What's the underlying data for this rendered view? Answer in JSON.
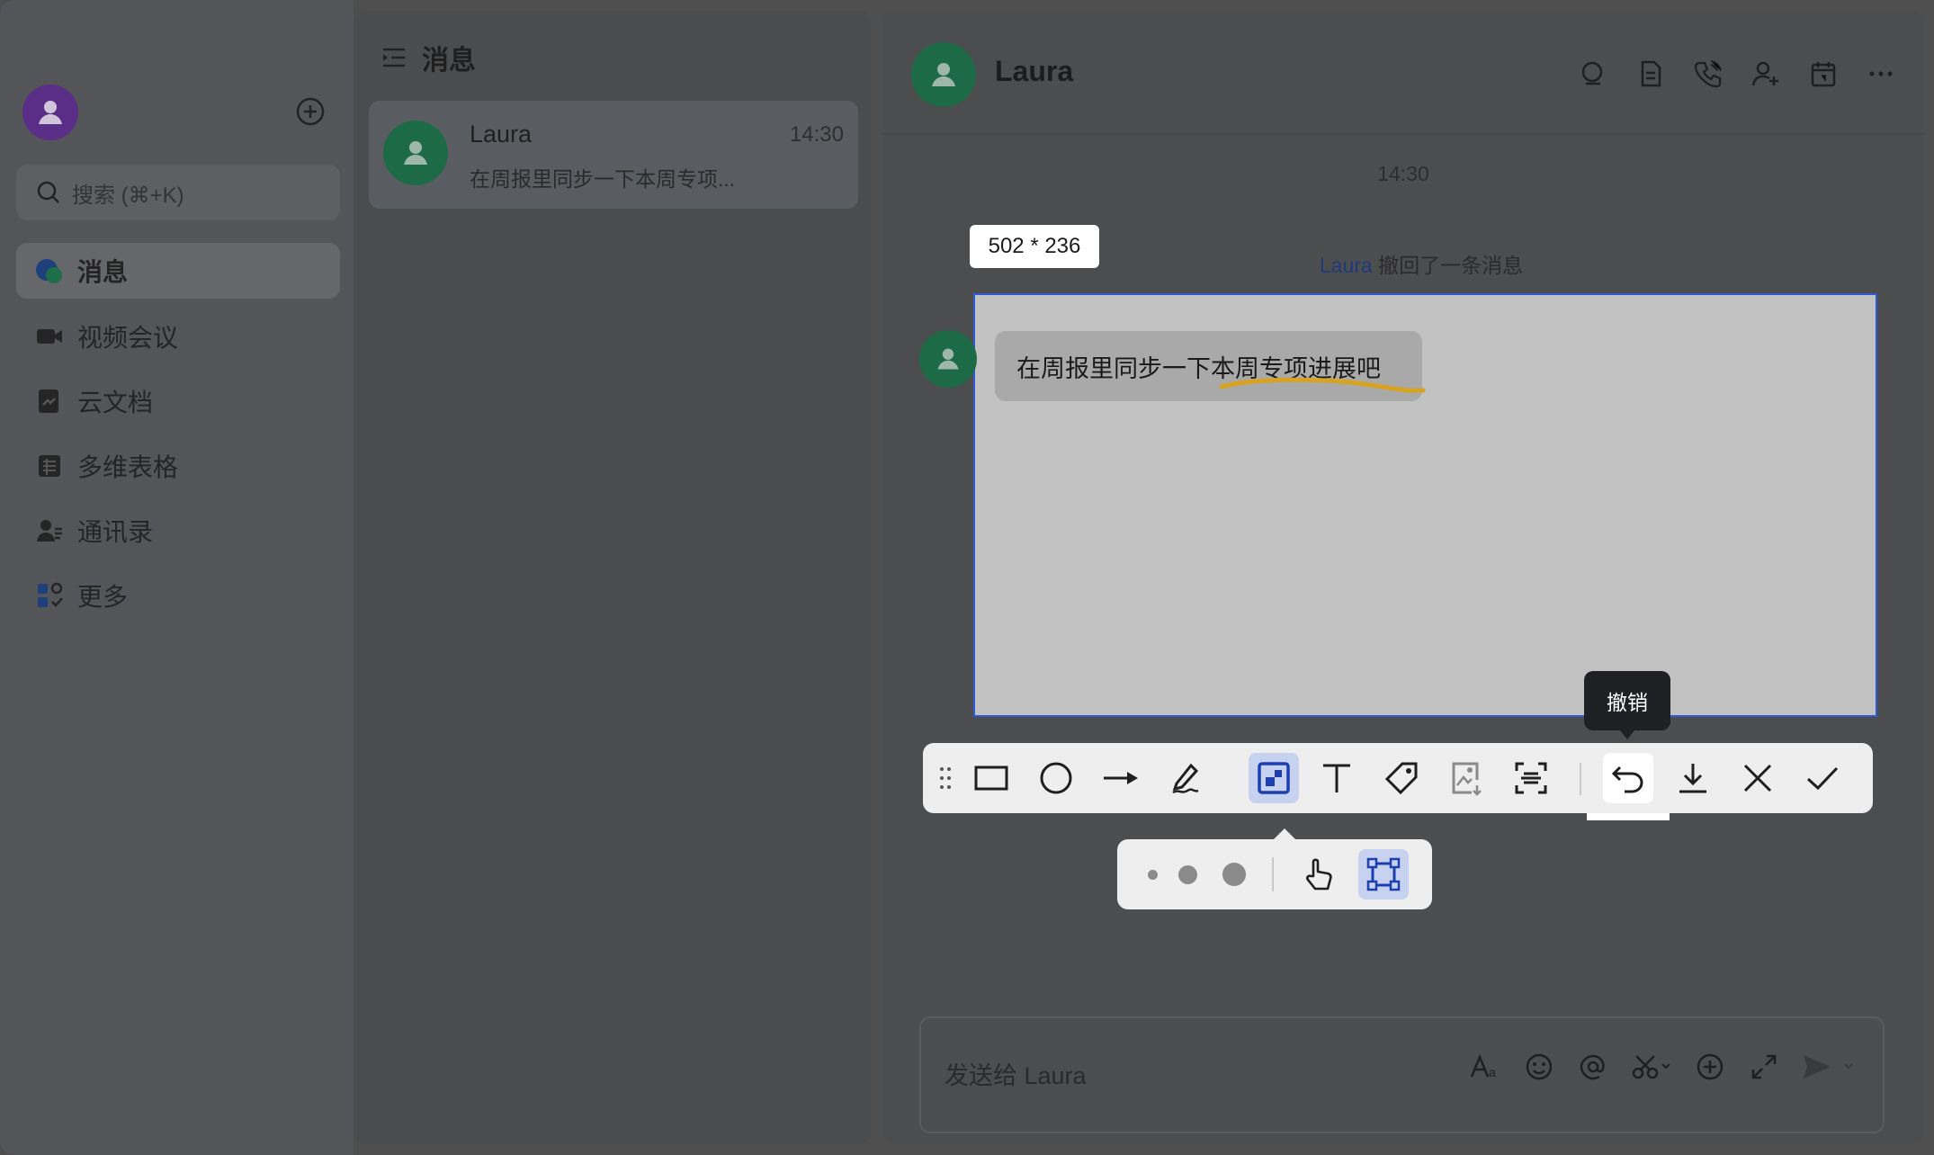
{
  "nav": {
    "search_placeholder": "搜索 (⌘+K)",
    "items": [
      {
        "label": "消息",
        "icon": "chat-icon"
      },
      {
        "label": "视频会议",
        "icon": "video-icon"
      },
      {
        "label": "云文档",
        "icon": "docs-icon"
      },
      {
        "label": "多维表格",
        "icon": "table-icon"
      },
      {
        "label": "通讯录",
        "icon": "contacts-icon"
      },
      {
        "label": "更多",
        "icon": "more-apps-icon"
      }
    ]
  },
  "list": {
    "title": "消息",
    "conversations": [
      {
        "name": "Laura",
        "time": "14:30",
        "preview": "在周报里同步一下本周专项..."
      }
    ]
  },
  "chat": {
    "title": "Laura",
    "timestamp": "14:30",
    "recall_name": "Laura",
    "recall_text": " 撤回了一条消息",
    "message": "在周报里同步一下本周专项进展吧",
    "input_placeholder": "发送给 Laura"
  },
  "capture": {
    "size_label": "502 * 236",
    "tooltip": "撤销",
    "selection_color": "#2b5bd8",
    "highlight_color": "#d7a321"
  }
}
